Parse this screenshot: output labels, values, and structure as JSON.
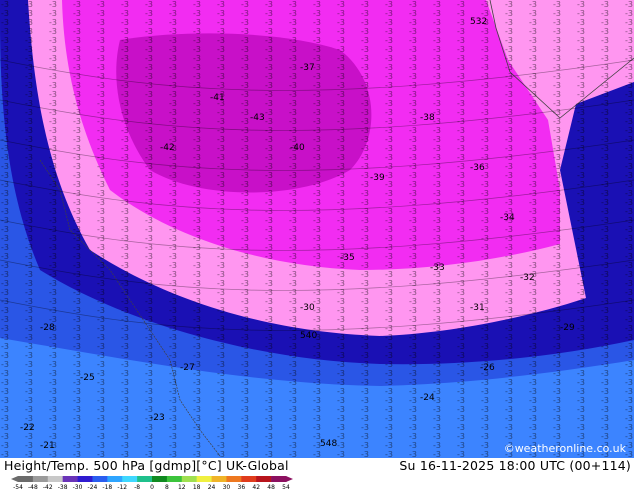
{
  "header": {
    "title": "Height/Temp. 500 hPa [gdmp][°C] UK-Global",
    "datetime": "Su 16-11-2025 18:00 UTC (00+114)",
    "credit": "©weatheronline.co.uk"
  },
  "legend": {
    "ticks": [
      "-54",
      "-48",
      "-42",
      "-38",
      "-30",
      "-24",
      "-18",
      "-12",
      "-8",
      "0",
      "8",
      "12",
      "18",
      "24",
      "30",
      "36",
      "42",
      "48",
      "54"
    ],
    "colors": [
      "#6b6b6b",
      "#9a9a9a",
      "#c8c8c8",
      "#6a34b8",
      "#2f1bd0",
      "#2a5ef0",
      "#2ea5ff",
      "#3fd8ff",
      "#1fc08c",
      "#108a20",
      "#3cc43c",
      "#a0e050",
      "#f0f040",
      "#f0b428",
      "#ee7820",
      "#e03c1c",
      "#b8141c",
      "#8c1060"
    ]
  },
  "map_labels": {
    "temperature_labels": [
      "-43",
      "-42",
      "-41",
      "-40",
      "-39",
      "-38",
      "-37",
      "-36",
      "-35",
      "-34",
      "-33",
      "-32",
      "-31",
      "-30",
      "-29",
      "-28",
      "-27",
      "-26",
      "-25",
      "-24",
      "-23",
      "-22",
      "-21"
    ],
    "height_labels": [
      "532",
      "540",
      "548"
    ]
  },
  "colors": {
    "land": "#b4f09e",
    "deep_blue": "#1a10b4",
    "mid_blue": "#2a56e6",
    "light_blue": "#3c84ff",
    "pink": "#ff96f0",
    "magenta": "#f22cf2",
    "violet": "#c810c8"
  }
}
